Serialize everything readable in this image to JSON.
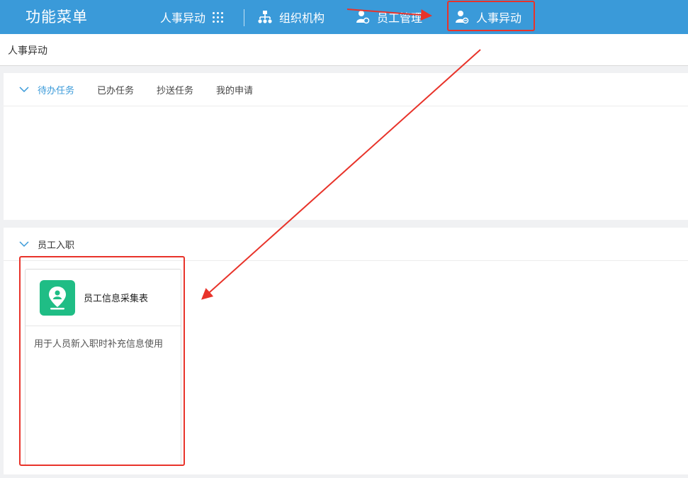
{
  "topbar": {
    "brand": "功能菜单",
    "nav": [
      {
        "label": "人事异动",
        "icon": "grid-dots-icon"
      },
      {
        "label": "组织机构",
        "icon": "org-chart-icon"
      },
      {
        "label": "员工管理",
        "icon": "user-settings-icon"
      },
      {
        "label": "人事异动",
        "icon": "user-transfer-icon"
      }
    ]
  },
  "titlebar": {
    "title": "人事异动"
  },
  "tasks_panel": {
    "tabs": [
      "待办任务",
      "已办任务",
      "抄送任务",
      "我的申请"
    ],
    "active_tab": "待办任务"
  },
  "onboard_panel": {
    "title": "员工入职",
    "card": {
      "title": "员工信息采集表",
      "description": "用于人员新入职时补充信息使用",
      "icon": "location-person-icon"
    }
  },
  "colors": {
    "topbar": "#3a9ad9",
    "accent": "#3a9ad9",
    "card_icon": "#1fbd85",
    "annotation": "#e8332a"
  }
}
